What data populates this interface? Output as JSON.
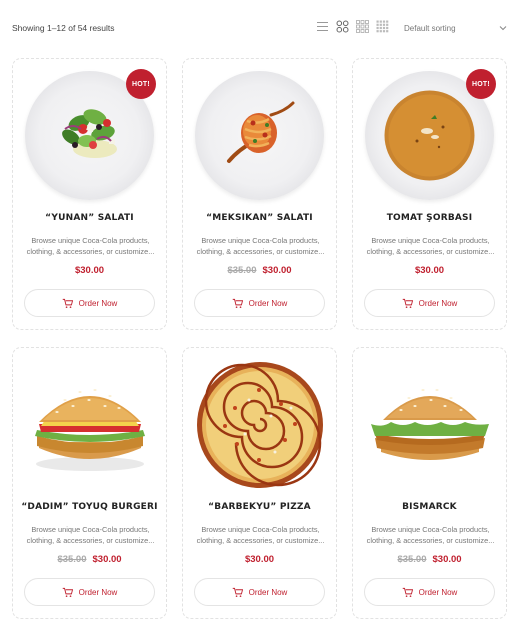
{
  "toolbar": {
    "result_count": "Showing 1–12 of 54 results",
    "sort_selected": "Default sorting",
    "view_icons": [
      "list-view-icon",
      "grid-2-icon",
      "grid-3-icon",
      "grid-4-icon"
    ]
  },
  "colors": {
    "accent": "#c0202f",
    "old_price": "#aaaaaa",
    "border": "#e2e2e2"
  },
  "products": [
    {
      "title": "“YUNAN” SALATI",
      "desc": "Browse unique Coca-Cola products, clothing, & accessories, or customize...",
      "old_price": "",
      "price": "$30.00",
      "badge": "HOT!",
      "button": "Order Now",
      "image": "greek-salad"
    },
    {
      "title": "“MEKSIKAN” SALATI",
      "desc": "Browse unique Coca-Cola products, clothing, & accessories, or customize...",
      "old_price": "$35.00",
      "price": "$30.00",
      "badge": "",
      "button": "Order Now",
      "image": "mexican-salad"
    },
    {
      "title": "TOMAT ŞORBASI",
      "desc": "Browse unique Coca-Cola products, clothing, & accessories, or customize...",
      "old_price": "",
      "price": "$30.00",
      "badge": "HOT!",
      "button": "Order Now",
      "image": "tomato-soup"
    },
    {
      "title": "“DADIM” TOYUQ BURGERI",
      "desc": "Browse unique Coca-Cola products, clothing, & accessories, or customize...",
      "old_price": "$35.00",
      "price": "$30.00",
      "badge": "",
      "button": "Order Now",
      "image": "chicken-burger"
    },
    {
      "title": "“BARBEKYU” PIZZA",
      "desc": "Browse unique Coca-Cola products, clothing, & accessories, or customize...",
      "old_price": "",
      "price": "$30.00",
      "badge": "",
      "button": "Order Now",
      "image": "bbq-pizza"
    },
    {
      "title": "BISMARCK",
      "desc": "Browse unique Coca-Cola products, clothing, & accessories, or customize...",
      "old_price": "$35.00",
      "price": "$30.00",
      "badge": "",
      "button": "Order Now",
      "image": "crispy-burger"
    }
  ]
}
